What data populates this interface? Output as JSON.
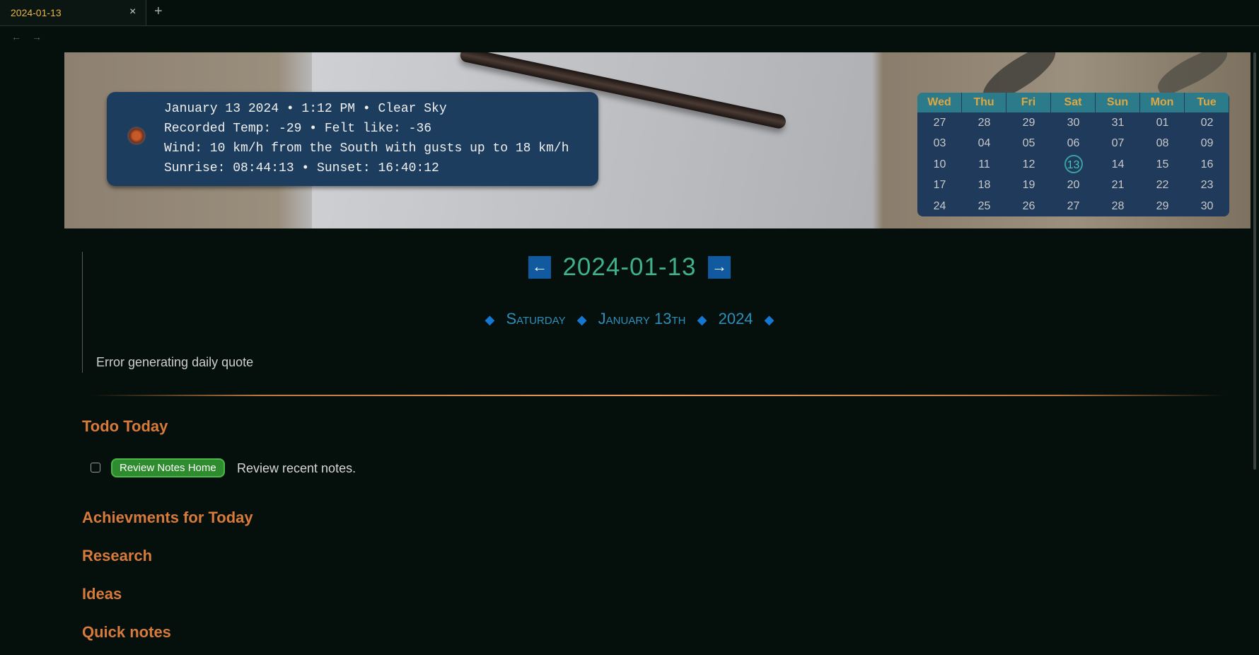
{
  "tab": {
    "title": "2024-01-13",
    "close_icon": "×",
    "new_icon": "+"
  },
  "nav": {
    "back_icon": "←",
    "forward_icon": "→"
  },
  "weather": {
    "icon": "sun-icon",
    "lines": [
      "January 13 2024 • 1:12 PM • Clear Sky",
      "Recorded Temp: -29 • Felt like: -36",
      "Wind: 10 km/h from the South with gusts up to 18 km/h",
      "Sunrise: 08:44:13 • Sunset: 16:40:12"
    ]
  },
  "calendar": {
    "headers": [
      "Wed",
      "Thu",
      "Fri",
      "Sat",
      "Sun",
      "Mon",
      "Tue"
    ],
    "weeks": [
      [
        "27",
        "28",
        "29",
        "30",
        "31",
        "01",
        "02"
      ],
      [
        "03",
        "04",
        "05",
        "06",
        "07",
        "08",
        "09"
      ],
      [
        "10",
        "11",
        "12",
        "13",
        "14",
        "15",
        "16"
      ],
      [
        "17",
        "18",
        "19",
        "20",
        "21",
        "22",
        "23"
      ],
      [
        "24",
        "25",
        "26",
        "27",
        "28",
        "29",
        "30"
      ]
    ],
    "today": "13",
    "accent": "#3aa0a0"
  },
  "date_header": {
    "prev_label": "←",
    "title": "2024-01-13",
    "next_label": "→",
    "weekday": "Saturday",
    "month_day": "January 13",
    "day_suffix": "th",
    "year": "2024",
    "separator": "◆"
  },
  "quote": {
    "text": "Error generating daily quote"
  },
  "sections": {
    "todo": "Todo Today",
    "achievements": "Achievments for Today",
    "research": "Research",
    "ideas": "Ideas",
    "quick_notes": "Quick notes"
  },
  "todo_item": {
    "tag": "Review Notes Home",
    "text": "Review recent notes.",
    "checked": false
  },
  "colors": {
    "background": "#050f0c",
    "heading": "#d77a3a",
    "date_title": "#3fb28a",
    "arrow_button": "#115aa0",
    "tag": "#2e8b2e"
  }
}
